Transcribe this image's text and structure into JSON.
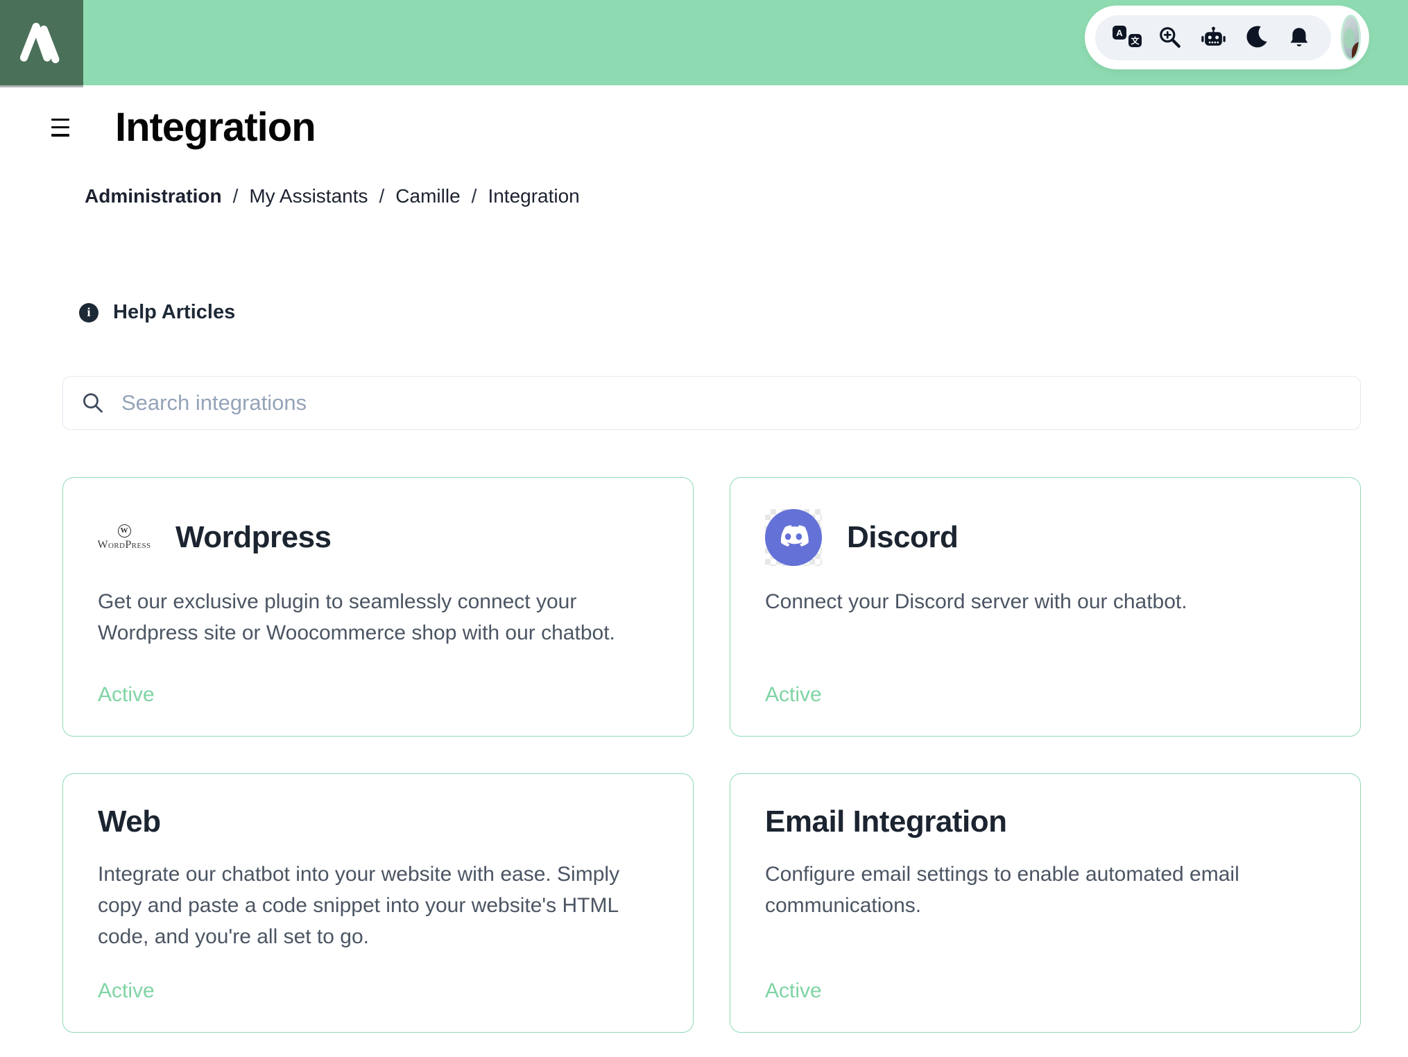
{
  "header": {
    "logo_name": "brand-a-mark",
    "toolbar_icons": [
      {
        "name": "translate-icon",
        "glyph_primary": "A",
        "glyph_secondary": "文"
      },
      {
        "name": "zoom-in-icon"
      },
      {
        "name": "robot-icon"
      },
      {
        "name": "moon-icon"
      },
      {
        "name": "bell-icon"
      }
    ],
    "avatar_name": "user-avatar"
  },
  "page": {
    "title": "Integration",
    "breadcrumb": {
      "separator": "/",
      "items": [
        "Administration",
        "My Assistants",
        "Camille",
        "Integration"
      ]
    },
    "help_label": "Help Articles",
    "help_icon_glyph": "i",
    "search_placeholder": "Search integrations",
    "search_value": ""
  },
  "logos": {
    "wordpress_initial": "W",
    "wordpress_wordmark": "WordPress"
  },
  "cards": [
    {
      "id": "wordpress",
      "title": "Wordpress",
      "description": "Get our exclusive plugin to seamlessly connect your Wordpress site or Woocommerce shop with our chatbot.",
      "status": "Active"
    },
    {
      "id": "discord",
      "title": "Discord",
      "description": "Connect your Discord server with our chatbot.",
      "status": "Active"
    },
    {
      "id": "web",
      "title": "Web",
      "description": "Integrate our chatbot into your website with ease. Simply copy and paste a code snippet into your website's HTML code, and you're all set to go.",
      "status": "Active"
    },
    {
      "id": "email",
      "title": "Email Integration",
      "description": "Configure email settings to enable automated email communications.",
      "status": "Active"
    }
  ],
  "colors": {
    "header_green": "#8fdbb1",
    "logo_square_green": "#4a7059",
    "card_border_green": "#8edbb4",
    "active_green": "#7fd4a4",
    "discord_blurple": "#6471d6",
    "text_dark": "#1e2936",
    "text_muted": "#4b5563",
    "placeholder_gray": "#94a3b8"
  }
}
